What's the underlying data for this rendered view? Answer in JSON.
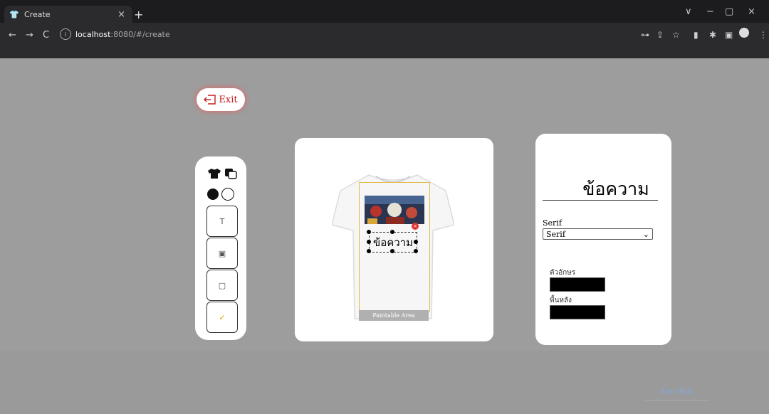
{
  "browser": {
    "tab_title": "Create",
    "tab_close": "×",
    "new_tab": "+",
    "back": "←",
    "forward": "→",
    "reload": "C",
    "url_host": "localhost",
    "url_path": ":8080/#/create",
    "window_controls": [
      "∨",
      "−",
      "▢",
      "×"
    ]
  },
  "page": {
    "exit_label": "Exit",
    "tools": {
      "text_tool": "T",
      "image_tool": "▣",
      "sticker_tool": "▢",
      "confirm_tool": "✓"
    },
    "canvas": {
      "paintable_label": "Paintable Area",
      "text_object": "ข้อความ"
    },
    "panel": {
      "title": "ข้อความ",
      "font_label": "Serif",
      "font_selected": "Serif",
      "text_color_label": "ตัวอักษร",
      "bg_color_label": "พื้นหลัง",
      "text_color": "#000000",
      "bg_color": "#000000"
    },
    "footer_button": "สั่งทำเสื้อนี้"
  }
}
